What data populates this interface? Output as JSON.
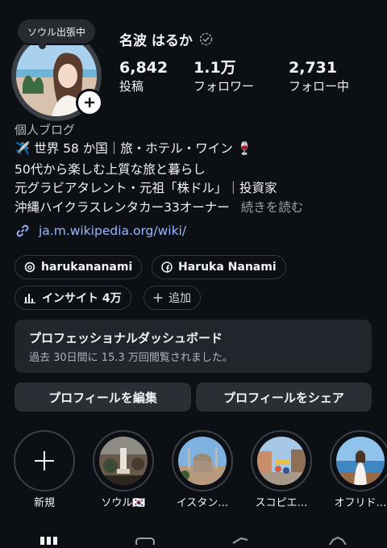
{
  "profile": {
    "note": "ソウル出張中",
    "name": "名波 はるか",
    "stats": [
      {
        "value": "6,842",
        "label": "投稿"
      },
      {
        "value": "1.1万",
        "label": "フォロワー"
      },
      {
        "value": "2,731",
        "label": "フォロー中"
      }
    ]
  },
  "bio": {
    "category": "個人ブログ",
    "lines": [
      "✈️ 世界 58 か国｜旅・ホテル・ワイン 🍷",
      "50代から楽しむ上質な旅と暮らし",
      "元グラビアタレント・元祖「株ドル」｜投資家",
      "沖縄ハイクラスレンタカー33オーナー"
    ],
    "more": "続きを読む",
    "link": "ja.m.wikipedia.org/wiki/"
  },
  "chips": {
    "threads": "harukananami",
    "facebook": "Haruka Nanami",
    "insights": "インサイト 4万",
    "add": "追加"
  },
  "dashboard": {
    "title": "プロフェッショナルダッシュボード",
    "subtitle": "過去 30日間に 15.3 万回閲覧されました。"
  },
  "buttons": {
    "edit": "プロフィールを編集",
    "share": "プロフィールをシェア"
  },
  "highlights": [
    {
      "label": "新規"
    },
    {
      "label": "ソウル🇰🇷"
    },
    {
      "label": "イスタン…"
    },
    {
      "label": "スコピエ…"
    },
    {
      "label": "オフリド…"
    }
  ],
  "colors": {
    "background": "#0c0f14",
    "surface": "#22262c",
    "button": "#2a2e35",
    "link": "#9bb7ff"
  }
}
